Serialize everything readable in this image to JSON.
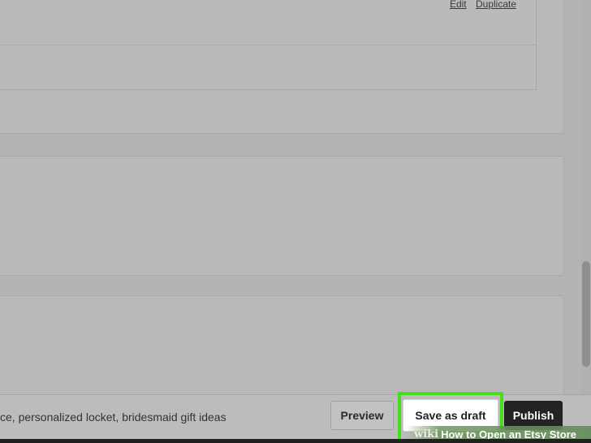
{
  "variation": {
    "edit_link": "Edit",
    "duplicate_link": "Duplicate"
  },
  "tags": {
    "text": "ce, personalized locket, bridesmaid gift ideas"
  },
  "actions": {
    "preview_label": "Preview",
    "save_draft_label": "Save as draft",
    "publish_label": "Publish"
  },
  "watermark": {
    "brand": "wiki",
    "title": "How to Open an Etsy Store"
  },
  "colors": {
    "highlight": "#45e01a",
    "publish_bg": "#232323",
    "overlay": "#b4b4b4"
  }
}
